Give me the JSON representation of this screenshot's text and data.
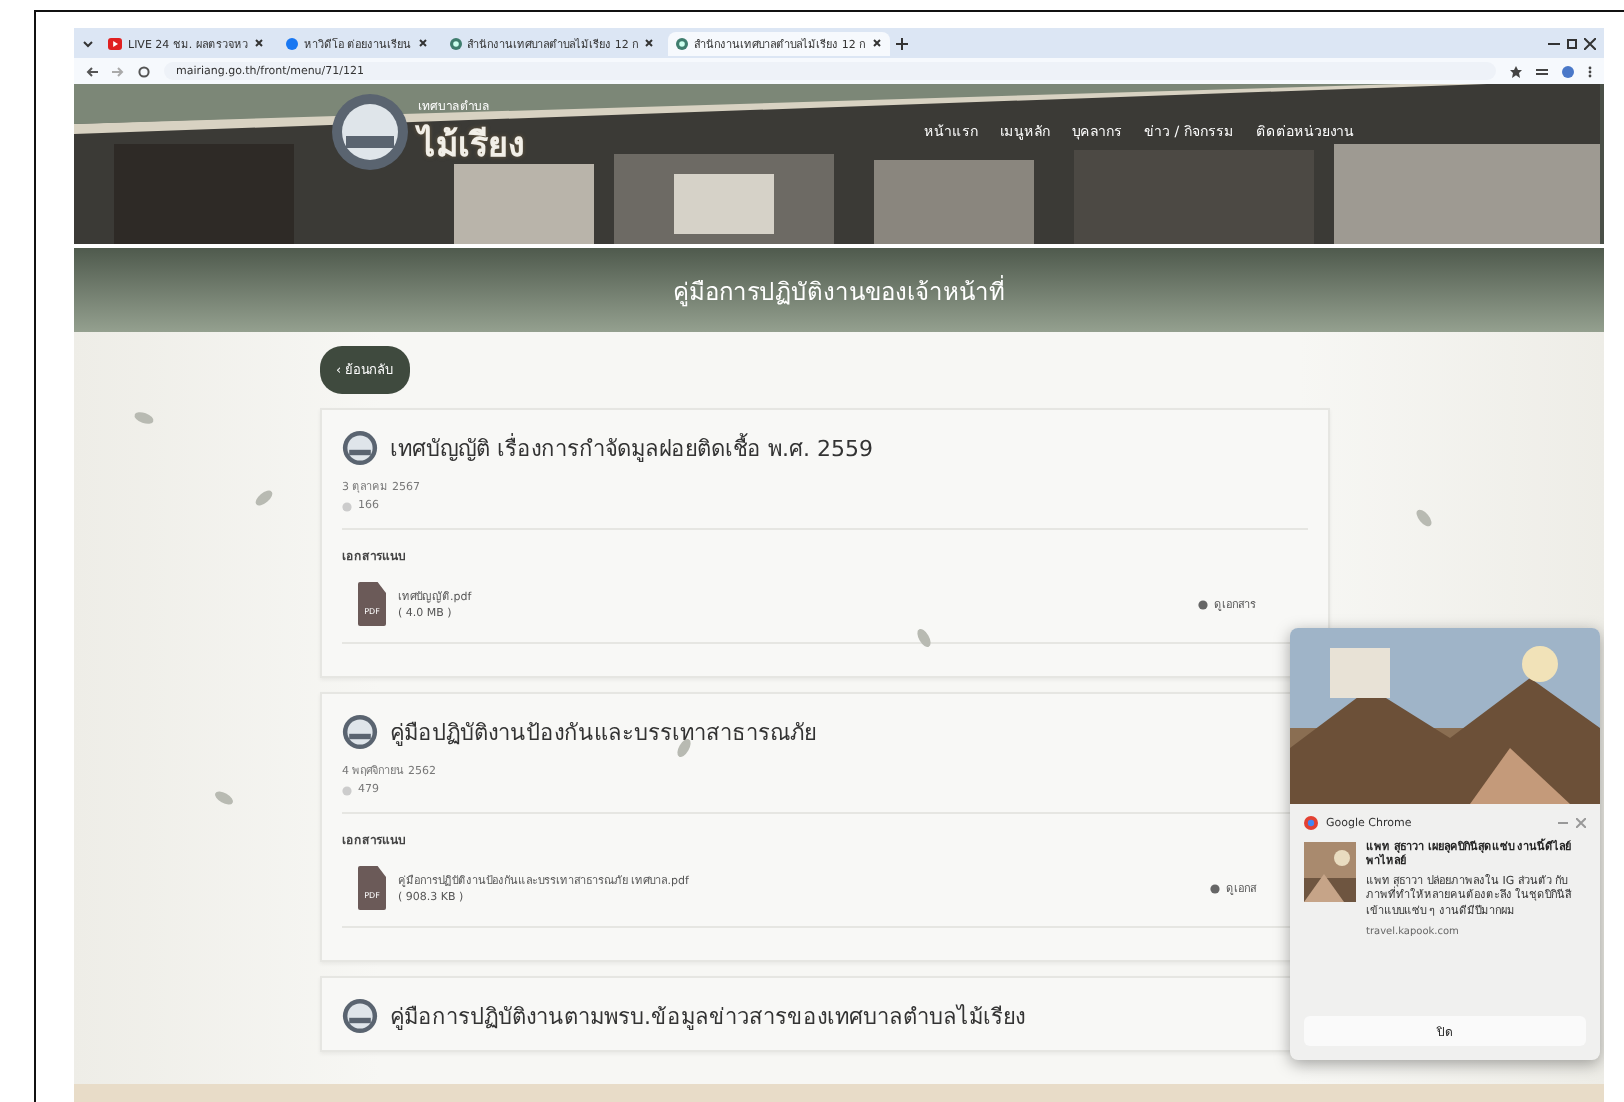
{
  "browser": {
    "tabs": [
      {
        "title": "LIVE 24 ชม. ผลตรวจหว",
        "kind": "video",
        "selected": false
      },
      {
        "title": "หาวิดีโอ ต่อยงานเรียน",
        "kind": "social",
        "selected": false
      },
      {
        "title": "สำนักงานเทศบาลตำบลไม้เรียง 12 ก",
        "kind": "site",
        "selected": false
      },
      {
        "title": "สำนักงานเทศบาลตำบลไม้เรียง 12 ก",
        "kind": "site",
        "selected": true
      }
    ],
    "url": "mairiang.go.th/front/menu/71/121"
  },
  "site": {
    "logo": {
      "line_1": "เทศบาลตำบล",
      "line_2": "ไม้เรียง"
    },
    "nav": [
      "หน้าแรก",
      "เมนูหลัก",
      "บุคลากร",
      "ข่าว / กิจกรรม",
      "ติดต่อหน่วยงาน"
    ],
    "page_title": "คู่มือการปฏิบัติงานของเจ้าหน้าที่",
    "back_button": "‹ ย้อนกลับ",
    "documents": [
      {
        "title": "เทศบัญญัติ เรื่องการกำจัดมูลฝอยติดเชื้อ พ.ศ. 2559",
        "date": "3 ตุลาคม 2567",
        "views": "166",
        "attachments_label": "เอกสารแนบ",
        "file": {
          "name": "เทศบัญญัติ.pdf",
          "size": "( 4.0 MB )",
          "type": "PDF"
        },
        "view_link": "ดูเอกสาร"
      },
      {
        "title": "คู่มือปฏิบัติงานป้องกันและบรรเทาสาธารณภัย",
        "date": "4 พฤศจิกายน 2562",
        "views": "479",
        "attachments_label": "เอกสารแนบ",
        "file": {
          "name": "คู่มือการปฏิบัติงานป้องกันและบรรเทาสาธารณภัย เทศบาล.pdf",
          "size": "( 908.3 KB )",
          "type": "PDF"
        },
        "view_link": "ดูเอกส"
      },
      {
        "title": "คู่มือการปฏิบัติงานตามพรบ.ข้อมูลข่าวสารของเทศบาลตำบลไม้เรียง"
      }
    ]
  },
  "notification": {
    "app": "Google Chrome",
    "title": "แพท สุธาวา เผยลุคบิกินีสุดแซ่บ งานนี้ดีไลย์ พาไหลย์",
    "body": "แพท สุธาวา ปล่อยภาพลงใน IG ส่วนตัว กับภาพที่ทำให้หลายคนต้องตะลึง ในชุดบิกินีสีเข้าแบบแซ่บ ๆ งานดีมีปีมากผม",
    "source": "travel.kapook.com",
    "button": "ปิด"
  }
}
